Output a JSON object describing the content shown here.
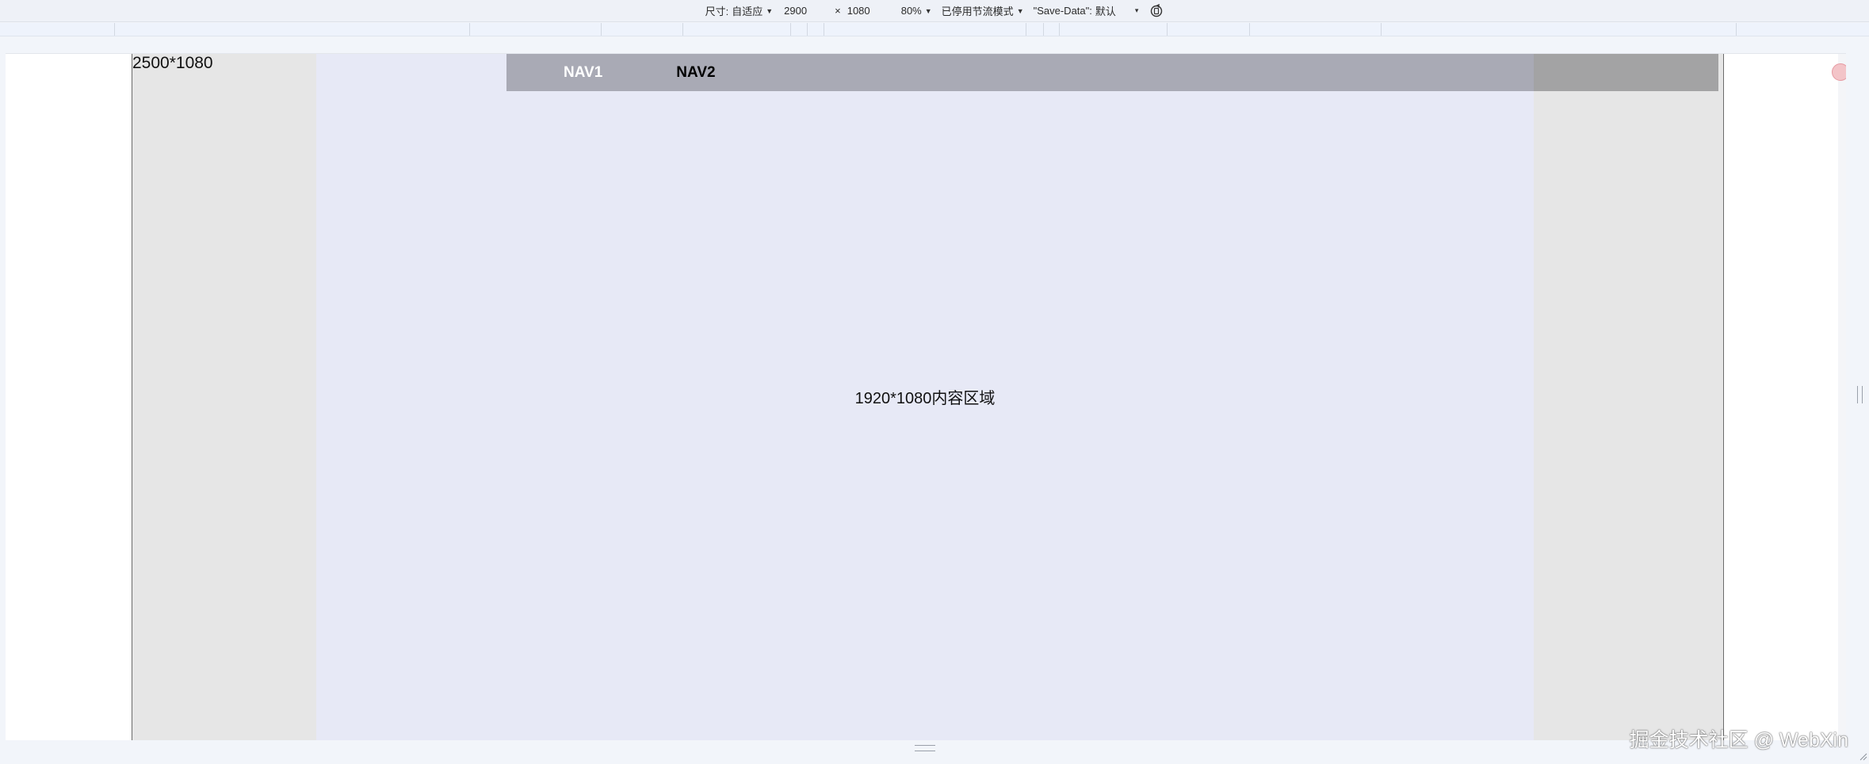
{
  "toolbar": {
    "size_label": "尺寸:",
    "size_mode": "自适应",
    "width_value": "2900",
    "times": "×",
    "height_value": "1080",
    "zoom": "80%",
    "throttle": "已停用节流模式",
    "save_data_label": "\"Save-Data\":",
    "save_data_value": "默认"
  },
  "viewport": {
    "canvas_label": "2500*1080",
    "content_label": "1920*1080内容区域",
    "nav": [
      "NAV1",
      "NAV2"
    ]
  },
  "watermark": "掘金技术社区 @ WebXin",
  "colors": {
    "canvas_bg": "#e6e6e6",
    "content_bg": "#e7e9f6",
    "nav_bg": "#a9aab5"
  }
}
